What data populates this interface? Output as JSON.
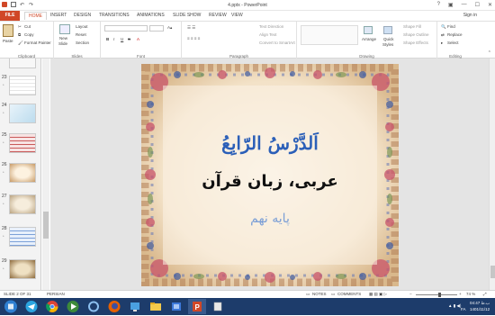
{
  "window": {
    "title": "4.pptx - PowerPoint",
    "help": "?"
  },
  "tabs": {
    "file": "FILE",
    "home": "HOME",
    "insert": "INSERT",
    "design": "DESIGN",
    "transitions": "TRANSITIONS",
    "animations": "ANIMATIONS",
    "slideshow": "SLIDE SHOW",
    "review": "REVIEW",
    "view": "VIEW",
    "signin": "Sign in"
  },
  "ribbon": {
    "clipboard": {
      "paste": "Paste",
      "cut": "Cut",
      "copy": "Copy",
      "format_painter": "Format Painter",
      "label": "Clipboard"
    },
    "slides": {
      "new_slide": "New",
      "new_slide2": "Slide",
      "layout": "Layout",
      "reset": "Reset",
      "section": "Section",
      "label": "Slides"
    },
    "font": {
      "bold": "B",
      "italic": "I",
      "underline": "U",
      "strike": "S",
      "label": "Font"
    },
    "paragraph": {
      "text_direction": "Text Direction",
      "align_text": "Align Text",
      "smartart": "Convert to SmartArt",
      "label": "Paragraph"
    },
    "drawing": {
      "arrange": "Arrange",
      "quick_styles": "Quick",
      "quick_styles2": "Styles",
      "shape_fill": "Shape Fill",
      "shape_outline": "Shape Outline",
      "shape_effects": "Shape Effects",
      "label": "Drawing"
    },
    "editing": {
      "find": "Find",
      "replace": "Replace",
      "select": "Select",
      "label": "Editing"
    }
  },
  "thumbnails": [
    {
      "num": "23",
      "star": "*"
    },
    {
      "num": "24",
      "star": "*"
    },
    {
      "num": "25",
      "star": "*"
    },
    {
      "num": "26",
      "star": "*"
    },
    {
      "num": "27",
      "star": "*"
    },
    {
      "num": "28",
      "star": "*"
    },
    {
      "num": "29",
      "star": "*"
    }
  ],
  "slide": {
    "line1": "اَلدَّرْسُ الرّابِعُ",
    "line2": "عربی، زبان قرآن",
    "line3": "پایه نهم"
  },
  "status": {
    "slide_of": "SLIDE 2 OF 31",
    "language": "PERSIAN",
    "notes": "NOTES",
    "comments": "COMMENTS",
    "zoom": "74 %"
  },
  "taskbar": {
    "time": "04:47 ب.ظ",
    "date": "1401/11/12",
    "lang": "FA"
  },
  "colors": {
    "accent": "#d04727",
    "taskbar": "#1d3c6b",
    "slide_title": "#2b5fb8",
    "slide_subtitle": "#111111",
    "slide_grade": "#7a9ed6"
  }
}
